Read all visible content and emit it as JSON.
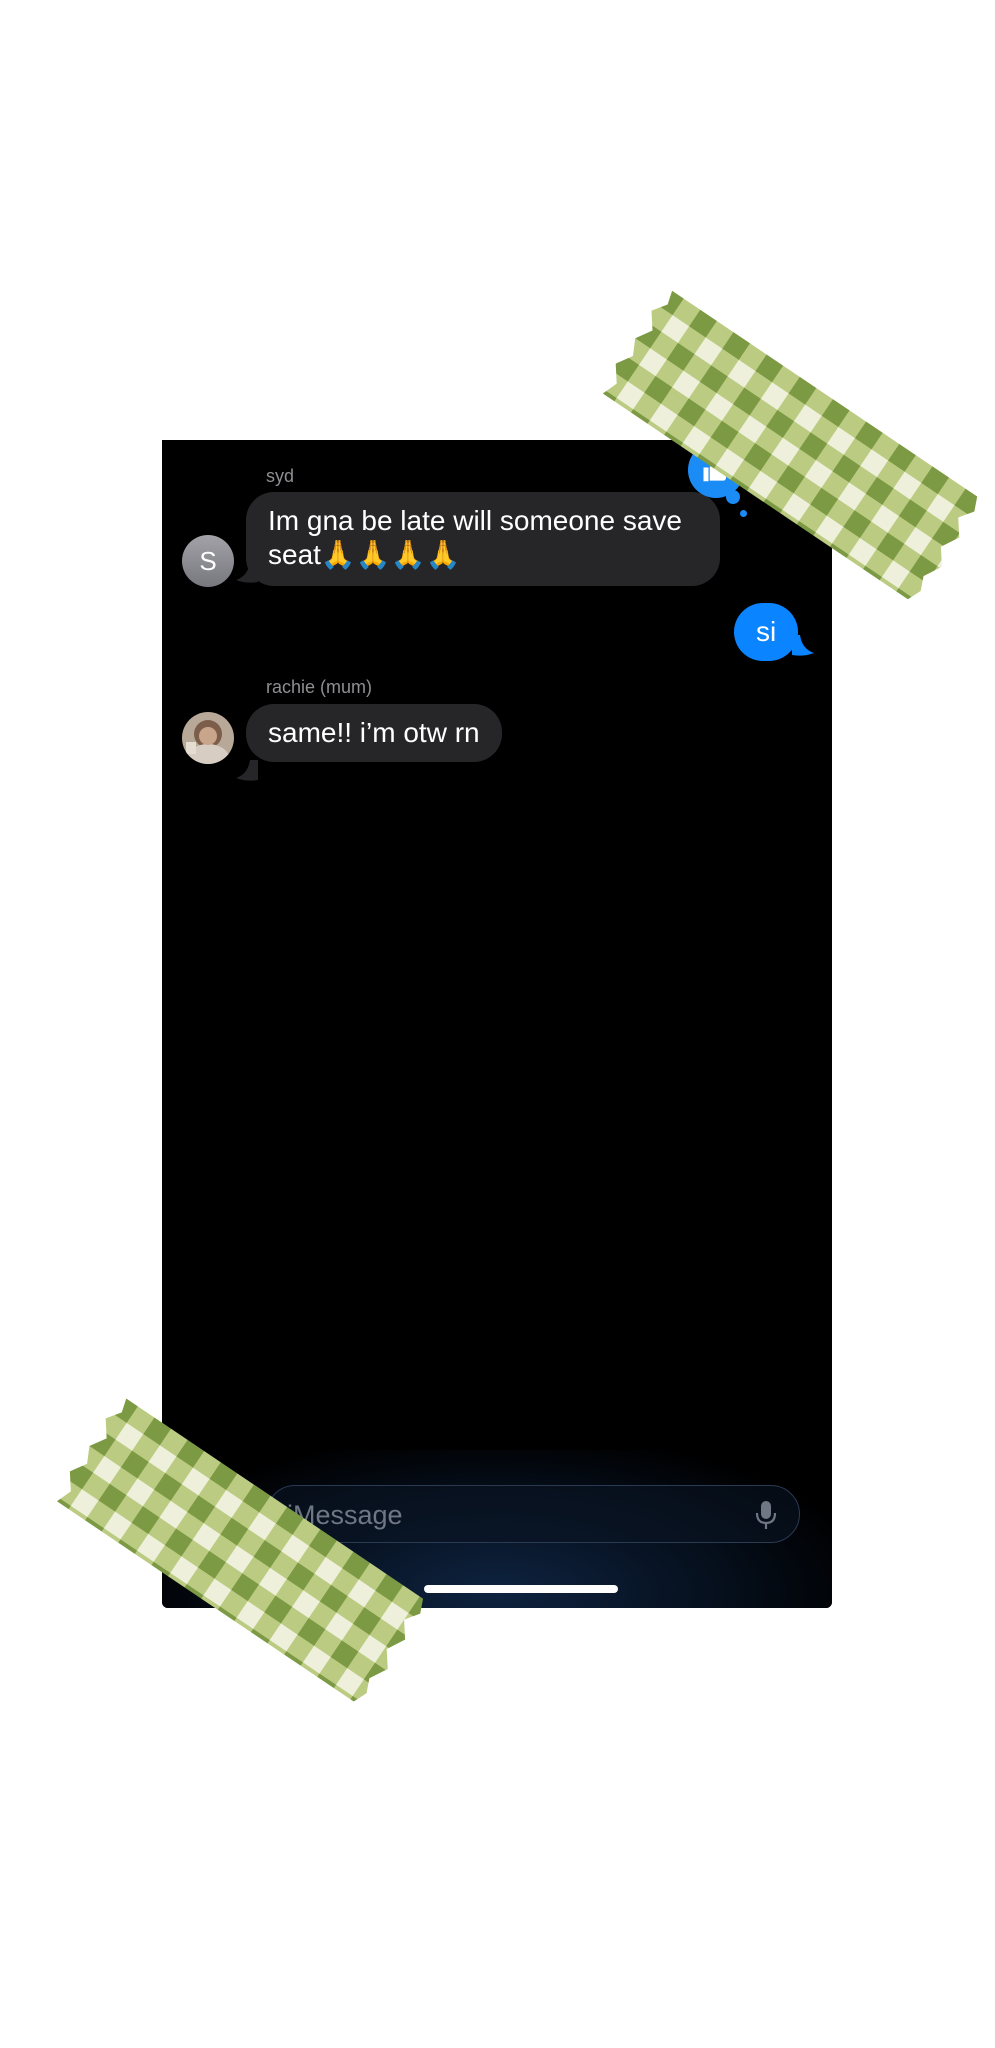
{
  "messages": [
    {
      "sender": "syd",
      "avatar_initial": "S",
      "text": "Im gna be late will someone save seat🙏🙏🙏🙏",
      "direction": "incoming",
      "reaction": "thumbs-up-icon"
    },
    {
      "text": "si",
      "direction": "outgoing"
    },
    {
      "sender": "rachie (mum)",
      "text": "same!! i’m otw rn",
      "direction": "incoming"
    }
  ],
  "composer": {
    "placeholder": "iMessage",
    "mic_icon": "microphone-icon"
  },
  "colors": {
    "outgoing_bubble": "#0a84ff",
    "incoming_bubble": "#262629",
    "tape_green": "#8ba84a"
  }
}
